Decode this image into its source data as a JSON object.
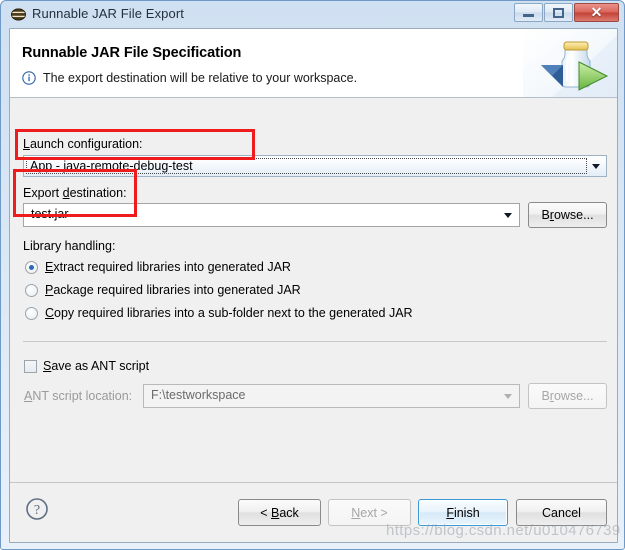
{
  "window": {
    "title": "Runnable JAR File Export",
    "icon": "jar-file-icon",
    "minimize_label": "Minimize",
    "maximize_label": "Maximize",
    "close_label": "Close",
    "close_glyph": "✕"
  },
  "banner": {
    "title": "Runnable JAR File Specification",
    "message": "The export destination will be relative to your workspace.",
    "info_icon": "info-icon",
    "art_icon": "jar-export-illustration"
  },
  "form": {
    "launch_configuration": {
      "label": "Launch configuration:",
      "value": "App - java-remote-debug-test"
    },
    "export_destination": {
      "label": "Export destination:",
      "value": "test.jar",
      "browse_label": "Browse..."
    },
    "library_handling": {
      "label": "Library handling:",
      "options": [
        {
          "label": "Extract required libraries into generated JAR",
          "selected": true
        },
        {
          "label": "Package required libraries into generated JAR",
          "selected": false
        },
        {
          "label": "Copy required libraries into a sub-folder next to the generated JAR",
          "selected": false
        }
      ]
    },
    "save_as_ant": {
      "label": "Save as ANT script",
      "checked": false
    },
    "ant_script_location": {
      "label": "ANT script location:",
      "value": "F:\\testworkspace",
      "browse_label": "Browse...",
      "enabled": false
    }
  },
  "buttonbar": {
    "help_icon": "help-icon",
    "back_label": "< Back",
    "next_label": "Next >",
    "finish_label": "Finish",
    "cancel_label": "Cancel"
  },
  "annotations": {
    "highlight_color": "#ee1c1c",
    "watermark": "https://blog.csdn.net/u010476739"
  }
}
